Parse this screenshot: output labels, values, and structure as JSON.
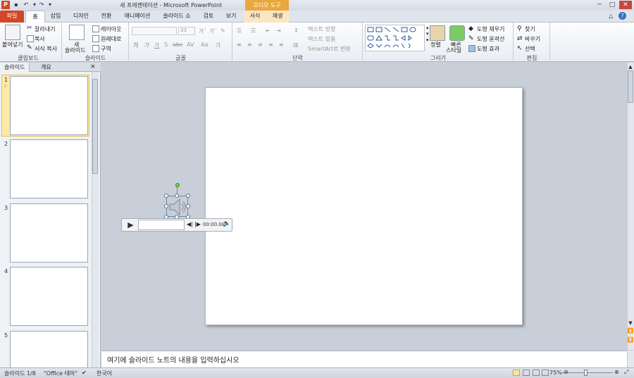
{
  "window": {
    "app_icon": "P",
    "title": "새 프레젠테이션 - Microsoft PowerPoint",
    "context_group": "오디오 도구",
    "min": "─",
    "max": "□",
    "close": "✕"
  },
  "tabs": [
    {
      "label": "파일"
    },
    {
      "label": "홈"
    },
    {
      "label": "삽입"
    },
    {
      "label": "디자인"
    },
    {
      "label": "전환"
    },
    {
      "label": "애니메이션"
    },
    {
      "label": "슬라이드 쇼"
    },
    {
      "label": "검토"
    },
    {
      "label": "보기"
    },
    {
      "label": "서식"
    },
    {
      "label": "재생"
    }
  ],
  "ribbon": {
    "clipboard": {
      "paste": "붙여넣기",
      "cut": "잘라내기",
      "copy": "복사",
      "format_painter": "서식 복사",
      "label": "클립보드"
    },
    "slides": {
      "new_slide_1": "새",
      "new_slide_2": "슬라이드",
      "layout": "레이아웃",
      "reset": "원래대로",
      "section": "구역",
      "label": "슬라이드"
    },
    "font": {
      "size": "33",
      "label": "글꼴"
    },
    "paragraph": {
      "text_direction": "텍스트 방향",
      "align_text": "텍스트 맞춤",
      "smartart": "SmartArt로 변환",
      "label": "단락"
    },
    "drawing": {
      "arrange": "정렬",
      "quick_styles_1": "빠른",
      "quick_styles_2": "스타일",
      "shape_fill": "도형 채우기",
      "shape_outline": "도형 윤곽선",
      "shape_effects": "도형 효과",
      "label": "그리기"
    },
    "editing": {
      "find": "찾기",
      "replace": "바꾸기",
      "select": "선택",
      "label": "편집"
    }
  },
  "left_panel": {
    "tab_slides": "슬라이드",
    "tab_outline": "개요",
    "close": "×",
    "slide_numbers": [
      "1",
      "2",
      "3",
      "4",
      "5"
    ]
  },
  "audio_player": {
    "time": "00:00.00"
  },
  "notes": {
    "placeholder": "여기에 슬라이드 노트의 내용을 입력하십시오"
  },
  "status": {
    "slide_info": "슬라이드 1/8",
    "theme": "\"Office 테마\"",
    "language": "한국어",
    "zoom": "75%"
  },
  "colors": {
    "file_tab": "#d24726",
    "context_tab": "#e8a83c",
    "selected_thumb": "#fde9a8"
  }
}
